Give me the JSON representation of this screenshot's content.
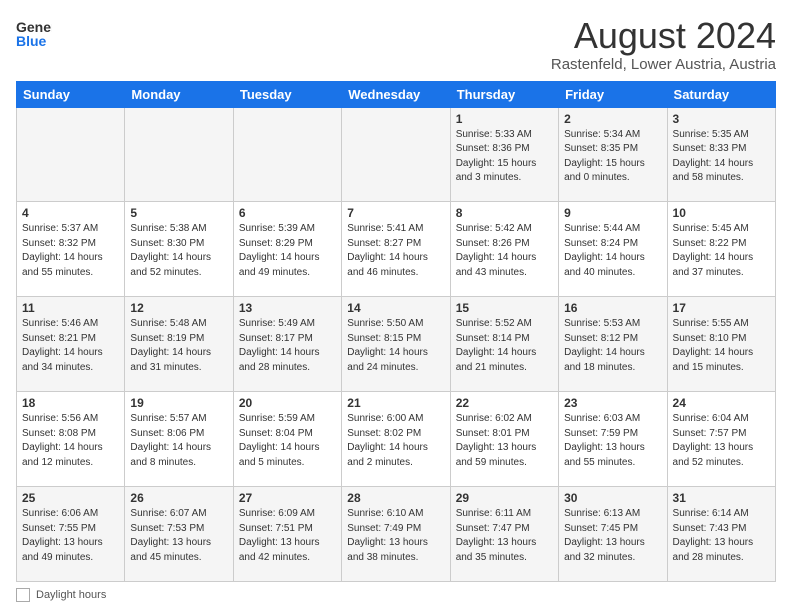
{
  "logo": {
    "general": "General",
    "blue": "Blue"
  },
  "title": "August 2024",
  "subtitle": "Rastenfeld, Lower Austria, Austria",
  "days_of_week": [
    "Sunday",
    "Monday",
    "Tuesday",
    "Wednesday",
    "Thursday",
    "Friday",
    "Saturday"
  ],
  "footer_label": "Daylight hours",
  "weeks": [
    [
      {
        "num": "",
        "info": ""
      },
      {
        "num": "",
        "info": ""
      },
      {
        "num": "",
        "info": ""
      },
      {
        "num": "",
        "info": ""
      },
      {
        "num": "1",
        "info": "Sunrise: 5:33 AM\nSunset: 8:36 PM\nDaylight: 15 hours\nand 3 minutes."
      },
      {
        "num": "2",
        "info": "Sunrise: 5:34 AM\nSunset: 8:35 PM\nDaylight: 15 hours\nand 0 minutes."
      },
      {
        "num": "3",
        "info": "Sunrise: 5:35 AM\nSunset: 8:33 PM\nDaylight: 14 hours\nand 58 minutes."
      }
    ],
    [
      {
        "num": "4",
        "info": "Sunrise: 5:37 AM\nSunset: 8:32 PM\nDaylight: 14 hours\nand 55 minutes."
      },
      {
        "num": "5",
        "info": "Sunrise: 5:38 AM\nSunset: 8:30 PM\nDaylight: 14 hours\nand 52 minutes."
      },
      {
        "num": "6",
        "info": "Sunrise: 5:39 AM\nSunset: 8:29 PM\nDaylight: 14 hours\nand 49 minutes."
      },
      {
        "num": "7",
        "info": "Sunrise: 5:41 AM\nSunset: 8:27 PM\nDaylight: 14 hours\nand 46 minutes."
      },
      {
        "num": "8",
        "info": "Sunrise: 5:42 AM\nSunset: 8:26 PM\nDaylight: 14 hours\nand 43 minutes."
      },
      {
        "num": "9",
        "info": "Sunrise: 5:44 AM\nSunset: 8:24 PM\nDaylight: 14 hours\nand 40 minutes."
      },
      {
        "num": "10",
        "info": "Sunrise: 5:45 AM\nSunset: 8:22 PM\nDaylight: 14 hours\nand 37 minutes."
      }
    ],
    [
      {
        "num": "11",
        "info": "Sunrise: 5:46 AM\nSunset: 8:21 PM\nDaylight: 14 hours\nand 34 minutes."
      },
      {
        "num": "12",
        "info": "Sunrise: 5:48 AM\nSunset: 8:19 PM\nDaylight: 14 hours\nand 31 minutes."
      },
      {
        "num": "13",
        "info": "Sunrise: 5:49 AM\nSunset: 8:17 PM\nDaylight: 14 hours\nand 28 minutes."
      },
      {
        "num": "14",
        "info": "Sunrise: 5:50 AM\nSunset: 8:15 PM\nDaylight: 14 hours\nand 24 minutes."
      },
      {
        "num": "15",
        "info": "Sunrise: 5:52 AM\nSunset: 8:14 PM\nDaylight: 14 hours\nand 21 minutes."
      },
      {
        "num": "16",
        "info": "Sunrise: 5:53 AM\nSunset: 8:12 PM\nDaylight: 14 hours\nand 18 minutes."
      },
      {
        "num": "17",
        "info": "Sunrise: 5:55 AM\nSunset: 8:10 PM\nDaylight: 14 hours\nand 15 minutes."
      }
    ],
    [
      {
        "num": "18",
        "info": "Sunrise: 5:56 AM\nSunset: 8:08 PM\nDaylight: 14 hours\nand 12 minutes."
      },
      {
        "num": "19",
        "info": "Sunrise: 5:57 AM\nSunset: 8:06 PM\nDaylight: 14 hours\nand 8 minutes."
      },
      {
        "num": "20",
        "info": "Sunrise: 5:59 AM\nSunset: 8:04 PM\nDaylight: 14 hours\nand 5 minutes."
      },
      {
        "num": "21",
        "info": "Sunrise: 6:00 AM\nSunset: 8:02 PM\nDaylight: 14 hours\nand 2 minutes."
      },
      {
        "num": "22",
        "info": "Sunrise: 6:02 AM\nSunset: 8:01 PM\nDaylight: 13 hours\nand 59 minutes."
      },
      {
        "num": "23",
        "info": "Sunrise: 6:03 AM\nSunset: 7:59 PM\nDaylight: 13 hours\nand 55 minutes."
      },
      {
        "num": "24",
        "info": "Sunrise: 6:04 AM\nSunset: 7:57 PM\nDaylight: 13 hours\nand 52 minutes."
      }
    ],
    [
      {
        "num": "25",
        "info": "Sunrise: 6:06 AM\nSunset: 7:55 PM\nDaylight: 13 hours\nand 49 minutes."
      },
      {
        "num": "26",
        "info": "Sunrise: 6:07 AM\nSunset: 7:53 PM\nDaylight: 13 hours\nand 45 minutes."
      },
      {
        "num": "27",
        "info": "Sunrise: 6:09 AM\nSunset: 7:51 PM\nDaylight: 13 hours\nand 42 minutes."
      },
      {
        "num": "28",
        "info": "Sunrise: 6:10 AM\nSunset: 7:49 PM\nDaylight: 13 hours\nand 38 minutes."
      },
      {
        "num": "29",
        "info": "Sunrise: 6:11 AM\nSunset: 7:47 PM\nDaylight: 13 hours\nand 35 minutes."
      },
      {
        "num": "30",
        "info": "Sunrise: 6:13 AM\nSunset: 7:45 PM\nDaylight: 13 hours\nand 32 minutes."
      },
      {
        "num": "31",
        "info": "Sunrise: 6:14 AM\nSunset: 7:43 PM\nDaylight: 13 hours\nand 28 minutes."
      }
    ]
  ]
}
